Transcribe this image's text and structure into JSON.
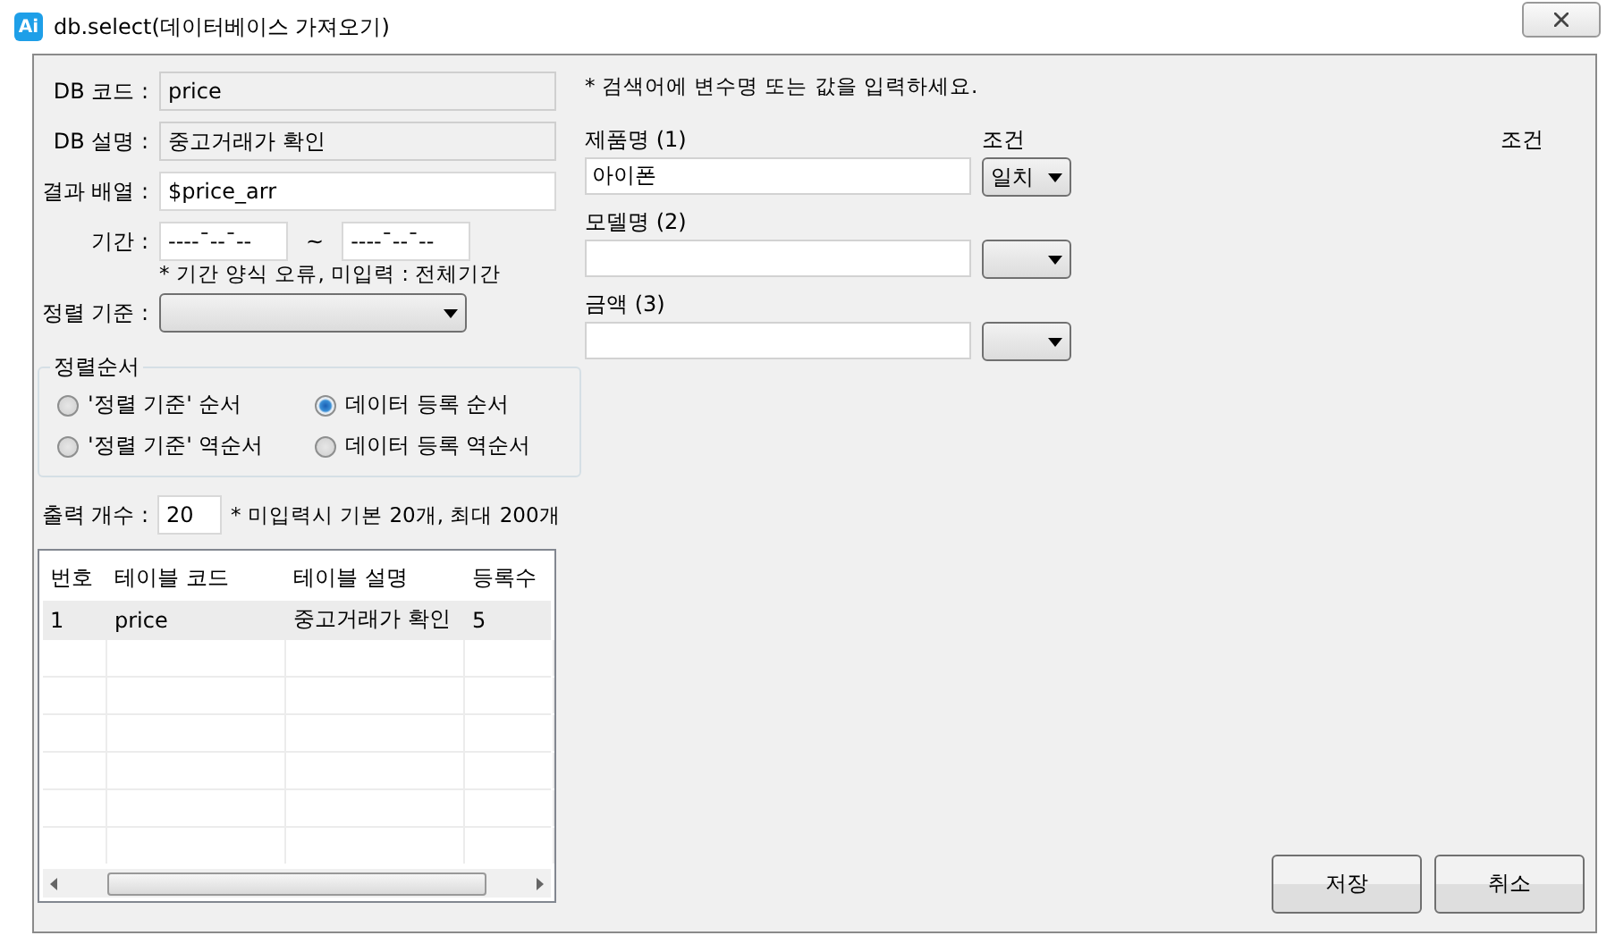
{
  "window": {
    "app_icon": "Ai",
    "title": "db.select(데이터베이스 가져오기)"
  },
  "fields": [
    {
      "label": "DB 코드 :",
      "value": "price",
      "disabled": true
    },
    {
      "label": "DB 설명 :",
      "value": "중고거래가 확인",
      "disabled": true
    },
    {
      "label": "결과 배열 :",
      "value": "$price_arr",
      "disabled": false
    }
  ],
  "period": {
    "label": "기간 :",
    "from": "----¯--¯--",
    "separator": "~",
    "to": "----¯--¯--",
    "note": "* 기간 양식 오류, 미입력 : 전체기간"
  },
  "sort": {
    "label": "정렬 기준 :"
  },
  "sort_order": {
    "title": "정렬순서",
    "options": [
      {
        "label": "'정렬 기준' 순서",
        "selected": false
      },
      {
        "label": "데이터 등록 순서",
        "selected": true
      },
      {
        "label": "'정렬 기준' 역순서",
        "selected": false
      },
      {
        "label": "데이터 등록 역순서",
        "selected": false
      }
    ]
  },
  "count": {
    "label": "출력 개수 :",
    "value": "20",
    "note": "* 미입력시 기본 20개, 최대 200개"
  },
  "table": {
    "columns": [
      "번호",
      "테이블 코드",
      "테이블 설명",
      "등록수"
    ],
    "rows": [
      {
        "cells": [
          "1",
          "price",
          "중고거래가 확인",
          "5"
        ],
        "selected": true
      }
    ]
  },
  "search": {
    "note": "* 검색어에 변수명 또는 값을 입력하세요.",
    "headers": [
      "조건",
      "조건"
    ],
    "rows": [
      {
        "label": "제품명 (1)",
        "value": "아이폰",
        "condition": "일치"
      },
      {
        "label": "모델명 (2)",
        "value": "",
        "condition": ""
      },
      {
        "label": "금액 (3)",
        "value": "",
        "condition": ""
      }
    ]
  },
  "buttons": [
    "저장",
    "취소"
  ]
}
